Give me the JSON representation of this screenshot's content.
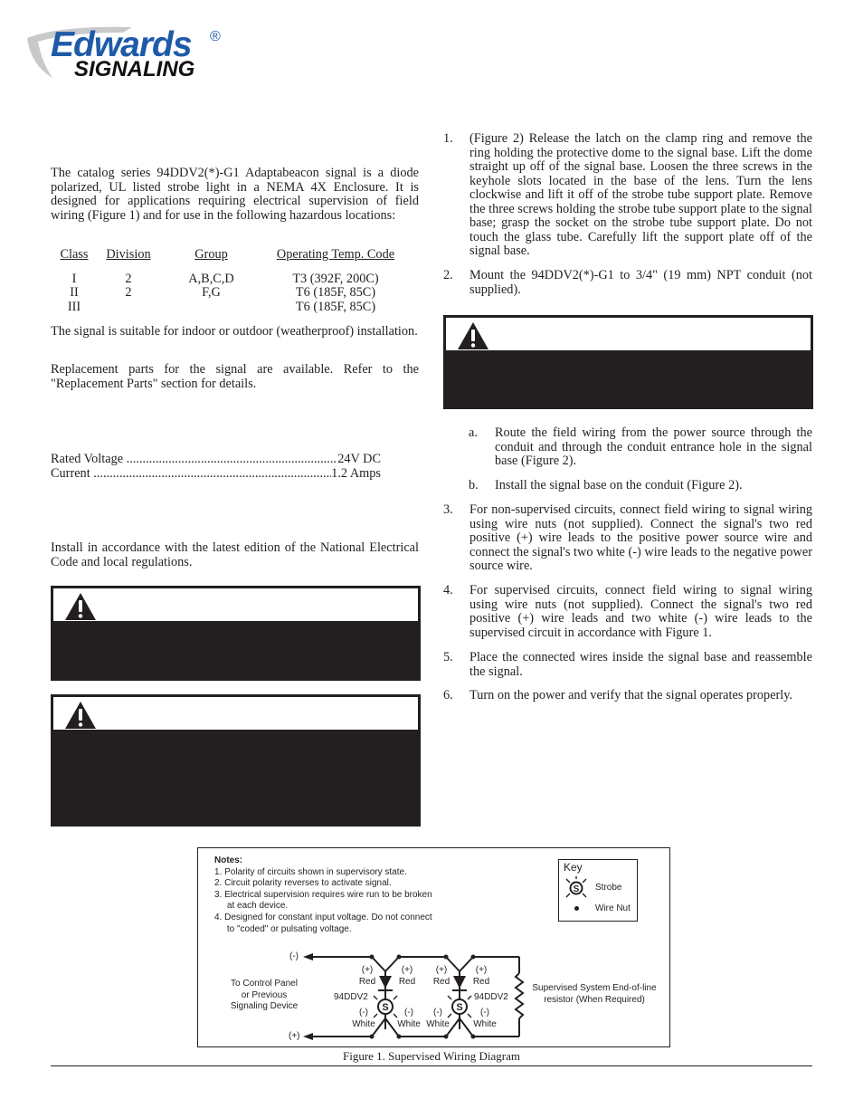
{
  "header": {
    "logo_brand": "Edwards",
    "logo_registered": "®",
    "logo_sub": "SIGNALING",
    "brand_color": "#1e5aa8"
  },
  "description": {
    "intro": "The catalog series 94DDV2(*)-G1 Adaptabeacon signal is a diode polarized, UL listed strobe light in a NEMA 4X Enclosure. It is designed for applications requiring electrical supervision of field wiring (Figure 1) and for use in the following hazardous locations:",
    "locations_table": {
      "headers": [
        "Class",
        "Division",
        "Group",
        "Operating Temp. Code"
      ],
      "rows": [
        [
          "I",
          "2",
          "A,B,C,D",
          "T3 (392F, 200C)"
        ],
        [
          "II",
          "2",
          "F,G",
          "T6 (185F, 85C)"
        ],
        [
          "III",
          "",
          "",
          "T6 (185F, 85C)"
        ]
      ]
    },
    "suitability": "The signal is suitable for indoor or outdoor (weatherproof) installation.",
    "replacement": "Replacement parts for the signal are available.  Refer to the \"Replacement Parts\" section for details."
  },
  "specifications": [
    {
      "label": "Rated Voltage",
      "value": "24V DC"
    },
    {
      "label": "Current",
      "value": "1.2 Amps"
    }
  ],
  "installation": {
    "intro": "Install in accordance with the latest edition of the National Electrical Code and local regulations.",
    "warning_icon": "warning-triangle-icon"
  },
  "steps": [
    {
      "num": "1.",
      "text": "(Figure 2)  Release the latch on the clamp ring and remove the ring holding the protective dome to the signal base.  Lift the dome straight up off of the signal base.  Loosen the three screws in the keyhole slots located in the base of the lens. Turn the lens clockwise and lift it off of the strobe tube support plate.  Remove the three screws holding the strobe tube support plate to the signal base; grasp the socket on the strobe tube support plate. Do not touch the glass tube.  Carefully lift the support plate off of the signal base."
    },
    {
      "num": "2.",
      "text": "Mount the 94DDV2(*)-G1 to 3/4\" (19 mm) NPT conduit (not supplied)."
    },
    {
      "num": "3.",
      "text": "For non-supervised circuits, connect field wiring to signal wiring using wire nuts (not supplied).  Connect the signal's two red positive (+) wire leads to the positive power source wire and connect the signal's two white (-) wire leads to the negative power source wire."
    },
    {
      "num": "4.",
      "text": "For supervised circuits, connect field wiring to signal wiring using wire nuts (not supplied).  Connect the signal's two red positive (+) wire leads and two white (-) wire leads to the supervised circuit in accordance with Figure 1."
    },
    {
      "num": "5.",
      "text": "Place the connected wires inside the signal base and reassemble the signal."
    },
    {
      "num": "6.",
      "text": "Turn on the power and verify that the signal operates properly."
    }
  ],
  "substeps": [
    {
      "num": "a.",
      "text": "Route the field wiring from the power source through the conduit and through the conduit entrance hole in the signal base (Figure 2)."
    },
    {
      "num": "b.",
      "text": "Install the signal base on the conduit (Figure 2)."
    }
  ],
  "figure1": {
    "notes_title": "Notes:",
    "notes": [
      "1.  Polarity of circuits shown in supervisory state.",
      "2.  Circuit polarity reverses to activate signal.",
      "3.  Electrical supervision requires wire run to be broken",
      "     at each device.",
      "4.  Designed for constant input voltage.  Do not connect",
      "     to \"coded\" or pulsating voltage."
    ],
    "key_title": "Key",
    "key_strobe": "Strobe",
    "key_strobe_symbol": "S",
    "key_wirenut": "Wire Nut",
    "neg_label": "(-)",
    "pos_label": "(+)",
    "source_label": [
      "To Control Panel",
      "or Previous",
      "Signaling Device"
    ],
    "red_plus": "(+)",
    "red": "Red",
    "white_minus": "(-)",
    "white": "White",
    "device": "94DDV2",
    "eol_label": [
      "Supervised System End-of-line",
      "resistor (When Required)"
    ],
    "caption": "Figure 1.  Supervised Wiring Diagram"
  }
}
